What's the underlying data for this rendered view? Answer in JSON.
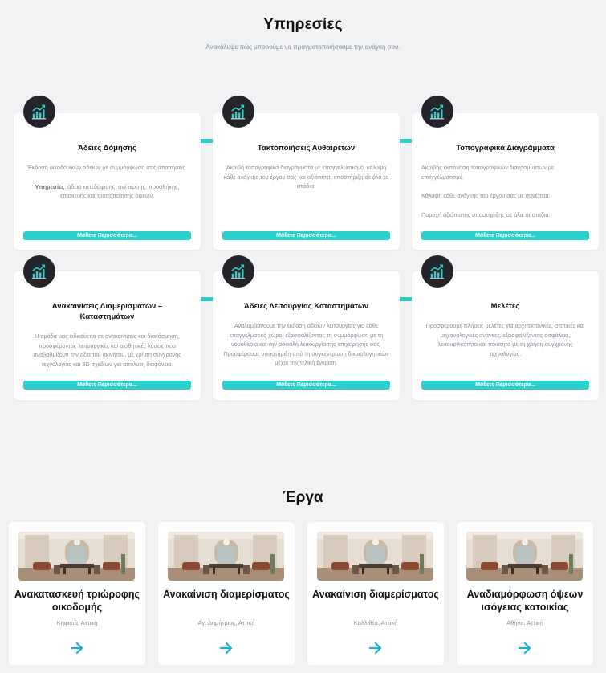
{
  "services": {
    "title": "Υπηρεσίες",
    "subtitle": "Ανακάλυψε πώς μπορούμε να πραγματοποιήσουμε την ανάγκη σου.",
    "button_label": "Μάθετε Περισσότερα...",
    "cards": [
      {
        "title": "Άδειες Δόμησης",
        "body_1": "Έκδοση οικοδομικών αδειών με συμμόρφωση στις απαιτήσεις.",
        "body_2_strong": "Υπηρεσίες",
        "body_2": ": άδεια κατεδάφισης, ανέγερσης, προσθήκης, επισκευής και τροποποίησης όψεων."
      },
      {
        "title": "Τακτοποιήσεις Αυθαιρέτων",
        "body": "Ακριβή τοπογραφικά διαγράμματα με επαγγελματισμό, κάλυψη κάθε ανάγκης του έργου σας και αξιόπιστη υποστήριξη σε όλα τα στάδια."
      },
      {
        "title": "Τοπογραφικά Διαγράμματα",
        "body_1": "Ακριβής εκπόνηση τοπογραφικών διαγραμμάτων με επαγγελματισμό.",
        "body_2": "Κάλυψη κάθε ανάγκης του έργου σας με συνέπεια.",
        "body_3": "Παροχή αξιόπιστης υποστήριξης σε όλα τα στάδια."
      },
      {
        "title": "Ανακαινίσεις Διαμερισμάτων – Καταστημάτων",
        "body": "Η ομάδα μας ειδικεύεται σε ανακαινίσεις και διακόσμηση, προσφέροντας λειτουργικές και αισθητικές λύσεις που αναβαθμίζουν την αξία του ακινήτου, με χρήση σύγχρονης τεχνολογίας και 3D σχεδίων για απόλυτη διαφάνεια."
      },
      {
        "title": "Άδειες Λειτουργίας Καταστημάτων",
        "body": "Αναλαμβάνουμε την έκδοση αδειών λειτουργίας για κάθε επαγγελματικό χώρο, εξασφαλίζοντας τη συμμόρφωση με τη νομοθεσία και την ασφαλή λειτουργία της επιχείρησής σας. Προσφέρουμε υποστήριξη από τη συγκέντρωση δικαιολογητικών μέχρι την τελική έγκριση."
      },
      {
        "title": "Μελέτες",
        "body": "Προσφέρουμε πλήρεις μελέτες για αρχιτεκτονικές, στατικές και μηχανολογικές ανάγκες, εξασφαλίζοντας ασφάλεια, λειτουργικότητα και ποιότητα με τη χρήση σύγχρονης τεχνολογίας."
      }
    ]
  },
  "projects": {
    "title": "Έργα",
    "items": [
      {
        "title": "Ανακατασκευή τριώροφης οικοδομής",
        "location": "Κηφισιά, Αττική"
      },
      {
        "title": "Ανακαίνιση διαμερίσματος",
        "location": "Αγ. Δημήτριος, Αττική"
      },
      {
        "title": "Ανακαίνιση διαμερίσματος",
        "location": "Καλλιθέα, Αττική"
      },
      {
        "title": "Αναδιαμόρφωση όψεων ισόγειας κατοικίας",
        "location": "Αθήνα, Αττική"
      }
    ]
  },
  "colors": {
    "accent": "#2ccfcb",
    "icon_bg": "#23252b",
    "page_bg": "#f1f2f4",
    "muted_text": "#8a8f99"
  },
  "icons": {
    "service": "chart-growth-icon",
    "project_link": "arrow-right-icon"
  }
}
